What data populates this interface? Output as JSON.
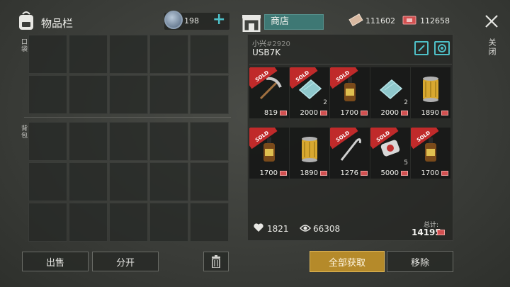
{
  "inventory": {
    "title": "物品栏",
    "coin_count": "198",
    "pocket_label": "口袋",
    "backpack_label": "背包",
    "sell_label": "出售",
    "split_label": "分开"
  },
  "shop": {
    "tab_label": "商店",
    "ticket_a_count": "111602",
    "ticket_b_count": "112658",
    "close_label": "关闭",
    "seller_name": "小兴",
    "seller_id": "#2920",
    "store_code": "USB7K",
    "sold_badge": "SOLD",
    "items": [
      {
        "icon": "pickaxe-icon",
        "price": "819",
        "qty": "",
        "sold": true
      },
      {
        "icon": "cloth-icon",
        "price": "2000",
        "qty": "2",
        "sold": true
      },
      {
        "icon": "bottle-icon",
        "price": "1700",
        "qty": "",
        "sold": true
      },
      {
        "icon": "cloth-icon",
        "price": "2000",
        "qty": "2",
        "sold": false
      },
      {
        "icon": "filter-icon",
        "price": "1890",
        "qty": "",
        "sold": false
      },
      {
        "icon": "bottle-icon",
        "price": "1700",
        "qty": "",
        "sold": true
      },
      {
        "icon": "filter-icon",
        "price": "1890",
        "qty": "",
        "sold": false
      },
      {
        "icon": "crowbar-icon",
        "price": "1276",
        "qty": "",
        "sold": true
      },
      {
        "icon": "dogtag-icon",
        "price": "5000",
        "qty": "5",
        "sold": true
      },
      {
        "icon": "bottle-icon",
        "price": "1700",
        "qty": "",
        "sold": true
      }
    ],
    "likes": "1821",
    "views": "66308",
    "total_label": "总计:",
    "total_value": "14195",
    "get_all_label": "全部获取",
    "remove_label": "移除"
  },
  "colors": {
    "accent": "#4ec0c8",
    "sold_red": "#c02a2a",
    "gold_button": "#b58a2a",
    "shop_tab": "#3e7874"
  }
}
